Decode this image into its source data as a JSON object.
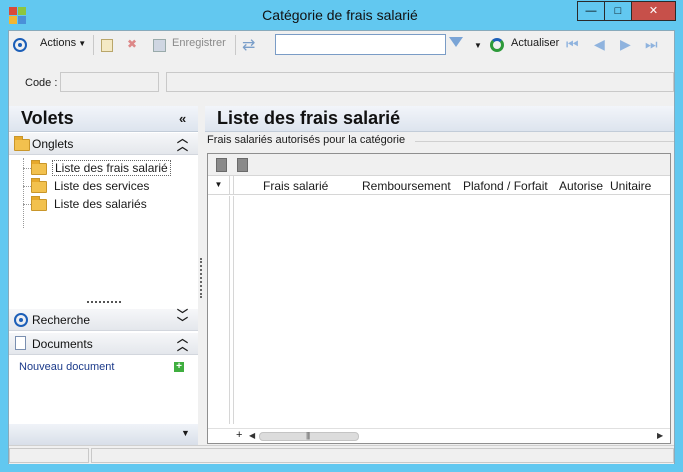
{
  "window": {
    "title": "Catégorie de frais salarié",
    "controls": {
      "minimize": "—",
      "maximize": "□",
      "close": "✕"
    }
  },
  "toolbar": {
    "actions_label": "Actions",
    "save_label": "Enregistrer",
    "refresh_label": "Actualiser",
    "search_value": ""
  },
  "code": {
    "label": "Code :",
    "value": ""
  },
  "left_panel": {
    "title": "Volets",
    "collapse_glyph": "«",
    "onglets": {
      "title": "Onglets",
      "items": [
        {
          "label": "Liste des frais salarié",
          "selected": true
        },
        {
          "label": "Liste des services",
          "selected": false
        },
        {
          "label": "Liste des salariés",
          "selected": false
        }
      ]
    },
    "recherche": {
      "title": "Recherche"
    },
    "documents": {
      "title": "Documents",
      "new_label": "Nouveau document"
    }
  },
  "main": {
    "title": "Liste des frais salarié",
    "group_label": "Frais salariés autorisés pour la catégorie",
    "columns": [
      "Frais salarié",
      "Remboursement",
      "Plafond / Forfait",
      "Autorise",
      "Unitaire"
    ],
    "rows": []
  },
  "colors": {
    "frame": "#62c8f0",
    "close_button": "#c7504a",
    "panel_header": "#dde4ee",
    "link": "#1b3a8a"
  }
}
